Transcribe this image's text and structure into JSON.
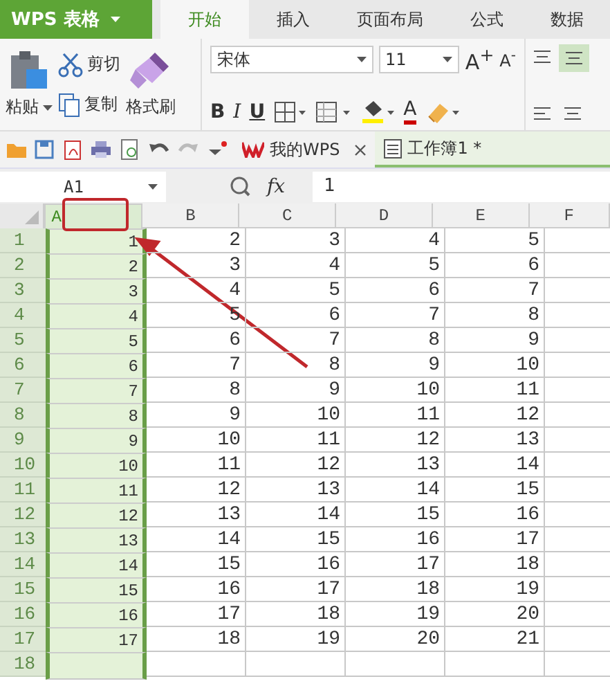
{
  "app_menu": {
    "label": "WPS 表格"
  },
  "ribbon_tabs": [
    {
      "label": "开始",
      "selected": true
    },
    {
      "label": "插入",
      "selected": false
    },
    {
      "label": "页面布局",
      "selected": false
    },
    {
      "label": "公式",
      "selected": false
    },
    {
      "label": "数据",
      "selected": false
    }
  ],
  "clipboard": {
    "paste": "粘贴",
    "cut": "剪切",
    "copy": "复制",
    "format_painter": "格式刷"
  },
  "font": {
    "name": "宋体",
    "size": "11",
    "grow": "A$^{+}$",
    "shrink": "A$^{-}$",
    "styles": [
      "B",
      "I",
      "U"
    ],
    "color_letter": "A"
  },
  "doc_tabs": [
    {
      "label": "我的WPS",
      "kind": "home",
      "selected": false
    },
    {
      "label": "工作簿1 *",
      "kind": "sheet",
      "selected": true
    }
  ],
  "formula_bar": {
    "cell_ref": "A1",
    "fx": "fx",
    "value": "1"
  },
  "sheet": {
    "columns": [
      {
        "label": "A",
        "selected": true
      },
      {
        "label": "B",
        "selected": false
      },
      {
        "label": "C",
        "selected": false
      },
      {
        "label": "D",
        "selected": false
      },
      {
        "label": "E",
        "selected": false
      },
      {
        "label": "F",
        "selected": false
      }
    ],
    "rows": [
      {
        "label": "1",
        "cells": [
          "1",
          "2",
          "3",
          "4",
          "5"
        ]
      },
      {
        "label": "2",
        "cells": [
          "2",
          "3",
          "4",
          "5",
          "6"
        ]
      },
      {
        "label": "3",
        "cells": [
          "3",
          "4",
          "5",
          "6",
          "7"
        ]
      },
      {
        "label": "4",
        "cells": [
          "4",
          "5",
          "6",
          "7",
          "8"
        ]
      },
      {
        "label": "5",
        "cells": [
          "5",
          "6",
          "7",
          "8",
          "9"
        ]
      },
      {
        "label": "6",
        "cells": [
          "6",
          "7",
          "8",
          "9",
          "10"
        ]
      },
      {
        "label": "7",
        "cells": [
          "7",
          "8",
          "9",
          "10",
          "11"
        ]
      },
      {
        "label": "8",
        "cells": [
          "8",
          "9",
          "10",
          "11",
          "12"
        ]
      },
      {
        "label": "9",
        "cells": [
          "9",
          "10",
          "11",
          "12",
          "13"
        ]
      },
      {
        "label": "10",
        "cells": [
          "10",
          "11",
          "12",
          "13",
          "14"
        ]
      },
      {
        "label": "11",
        "cells": [
          "11",
          "12",
          "13",
          "14",
          "15"
        ]
      },
      {
        "label": "12",
        "cells": [
          "12",
          "13",
          "14",
          "15",
          "16"
        ]
      },
      {
        "label": "13",
        "cells": [
          "13",
          "14",
          "15",
          "16",
          "17"
        ]
      },
      {
        "label": "14",
        "cells": [
          "14",
          "15",
          "16",
          "17",
          "18"
        ]
      },
      {
        "label": "15",
        "cells": [
          "15",
          "16",
          "17",
          "18",
          "19"
        ]
      },
      {
        "label": "16",
        "cells": [
          "16",
          "17",
          "18",
          "19",
          "20"
        ]
      },
      {
        "label": "17",
        "cells": [
          "17",
          "18",
          "19",
          "20",
          "21"
        ]
      },
      {
        "label": "18",
        "cells": []
      }
    ]
  }
}
